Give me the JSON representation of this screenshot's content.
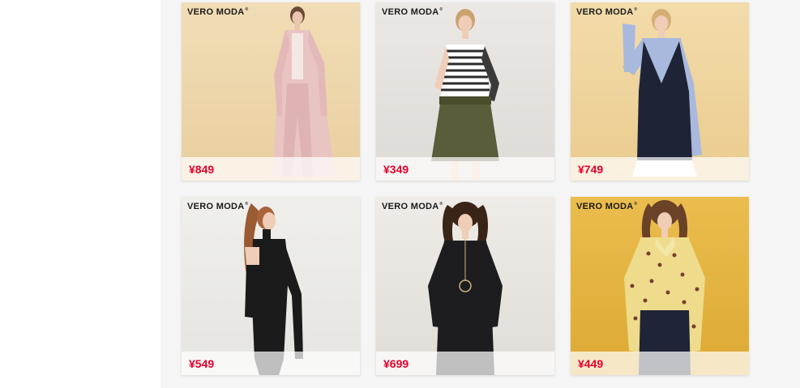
{
  "products": [
    {
      "brand": "VERO MODA",
      "price": "¥849",
      "bg": "#ecd8ad",
      "icon": "model-pink-trench-coat"
    },
    {
      "brand": "VERO MODA",
      "price": "¥349",
      "bg": "#e4e0dd",
      "icon": "model-striped-top-olive-skirt"
    },
    {
      "brand": "VERO MODA",
      "price": "¥749",
      "bg": "#efd49e",
      "icon": "model-navy-pinafore-dress"
    },
    {
      "brand": "VERO MODA",
      "price": "¥549",
      "bg": "#ebeae6",
      "icon": "model-black-cold-shoulder-knit"
    },
    {
      "brand": "VERO MODA",
      "price": "¥699",
      "bg": "#e8e4de",
      "icon": "model-black-knit-dress"
    },
    {
      "brand": "VERO MODA",
      "price": "¥449",
      "bg": "#e4b33f",
      "icon": "model-yellow-floral-blouse"
    }
  ],
  "colors": {
    "price": "#e4002b",
    "panel": "#f5f5f5"
  }
}
